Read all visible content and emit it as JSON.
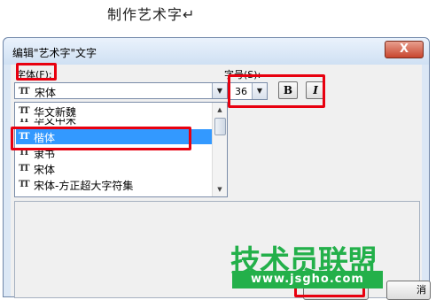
{
  "document": {
    "text": "制作艺术字↵"
  },
  "dialog": {
    "title": "编辑\"艺术字\"文字",
    "close_label": "X",
    "font_label": "字体(F):",
    "size_label": "字号(S):",
    "font_selected": "宋体",
    "font_size": "36",
    "bold_label": "B",
    "italic_label": "I",
    "font_list": [
      "华文新魏",
      "华文中宋",
      "楷体",
      "隶书",
      "宋体",
      "宋体-方正超大字符集"
    ],
    "selected_font": "楷体",
    "cancel_label": "消"
  },
  "icons": {
    "truetype": "TT",
    "dropdown": "▼",
    "scroll_up": "▲",
    "scroll_down": "▼"
  },
  "watermark": {
    "title": "技术员联盟",
    "url": "www.jsgho.com"
  },
  "colors": {
    "highlight": "#e8000f",
    "selection": "#3399ff",
    "watermark": "#23b04a"
  }
}
